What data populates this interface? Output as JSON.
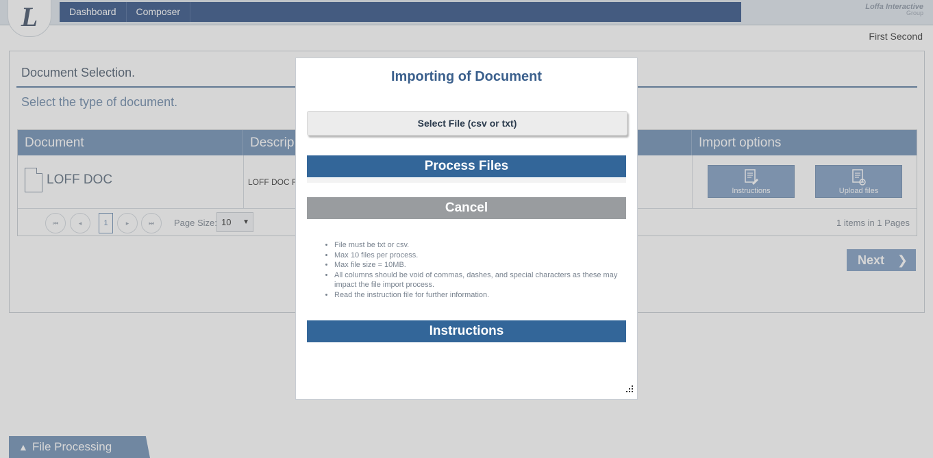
{
  "header": {
    "logo_letter": "L",
    "nav": [
      "Dashboard",
      "Composer"
    ],
    "brand_line1": "Loffa Interactive",
    "brand_line2": "Group",
    "user_name": "First Second"
  },
  "panel": {
    "title": "Document Selection.",
    "subtitle": "Select the type of document.",
    "columns": [
      "Document",
      "Descrip",
      "Import options"
    ],
    "row": {
      "document": "LOFF DOC",
      "description": "LOFF DOC FC",
      "instructions_label": "Instructions",
      "upload_label": "Upload files"
    },
    "pager": {
      "first": "⏮",
      "prev": "◂",
      "current_page": "1",
      "next": "▸",
      "last": "⏭",
      "page_size_label": "Page Size:",
      "page_size": "10",
      "info": "1 items in 1 Pages"
    },
    "next_label": "Next",
    "next_icon": "❯"
  },
  "footer": {
    "file_processing_label": "File Processing",
    "file_processing_icon": "▲"
  },
  "modal": {
    "title": "Importing of Document",
    "select_file_label": "Select File (csv or txt)",
    "process_label": "Process Files",
    "cancel_label": "Cancel",
    "notes": [
      "File must be txt or csv.",
      "Max 10 files per process.",
      "Max file size = 10MB.",
      "All columns should be void of commas, dashes, and special characters as these may impact the file import process.",
      "Read the instruction file for further information."
    ],
    "instructions_label": "Instructions"
  },
  "colors": {
    "nav_bg": "#2f4f84",
    "grid_header": "#6e8eb4",
    "primary_button": "#336699",
    "cancel_button": "#999c9f"
  }
}
